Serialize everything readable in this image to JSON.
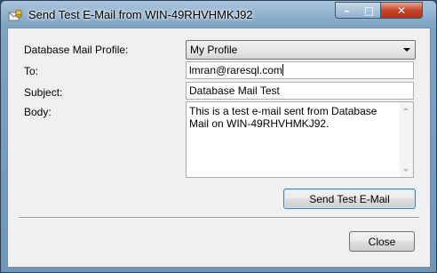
{
  "window": {
    "title": "Send Test E-Mail from WIN-49RHVHMKJ92",
    "controls": {
      "minimize": "–",
      "maximize": "□",
      "close": "✕"
    },
    "icon": "database-mail-icon"
  },
  "form": {
    "profile_label": "Database Mail Profile:",
    "profile_value": "My Profile",
    "to_label": "To:",
    "to_value": "lmran@raresql.com",
    "subject_label": "Subject:",
    "subject_value": "Database Mail Test",
    "body_label": "Body:",
    "body_value": "This is a test e-mail sent from Database Mail on WIN-49RHVHMKJ92."
  },
  "buttons": {
    "send_label": "Send Test E-Mail",
    "close_label": "Close"
  }
}
